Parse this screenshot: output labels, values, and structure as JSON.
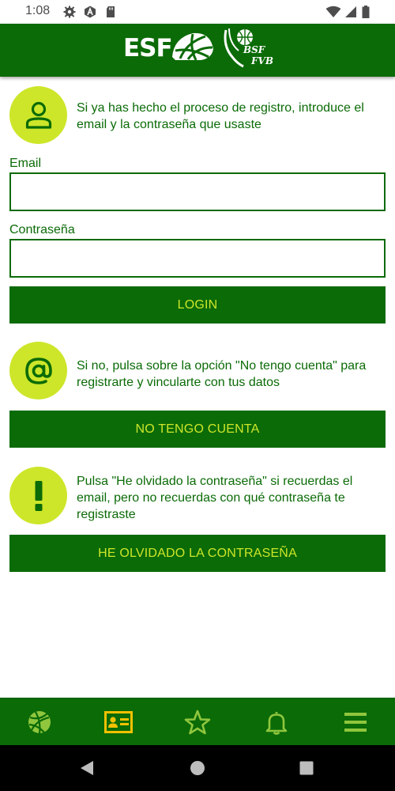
{
  "status_bar": {
    "time": "1:08",
    "icons_left": [
      "gear-icon",
      "a-icon",
      "sd-card-icon"
    ],
    "icons_right": [
      "wifi-icon",
      "signal-icon",
      "battery-icon"
    ]
  },
  "header": {
    "logo_primary": "ESF",
    "logo_secondary_line1": "BSF",
    "logo_secondary_line2": "FVB",
    "background": "#0b6b07"
  },
  "login_section": {
    "icon": "user-icon",
    "text": "Si ya has hecho el proceso de registro, introduce el email y la contraseña que usaste",
    "email_label": "Email",
    "email_value": "",
    "password_label": "Contraseña",
    "password_value": "",
    "login_button": "LOGIN"
  },
  "register_section": {
    "icon": "at-icon",
    "text": "Si no, pulsa sobre la opción \"No tengo cuenta\" para registrarte y vincularte con tus datos",
    "button": "NO TENGO CUENTA"
  },
  "forgot_section": {
    "icon": "exclamation-icon",
    "text": "Pulsa \"He olvidado la contraseña\" si recuerdas el email, pero no recuerdas con qué contraseña te registraste",
    "button": "HE OLVIDADO LA CONTRASEÑA"
  },
  "bottom_nav": {
    "items": [
      {
        "icon": "basketball-icon",
        "active": false
      },
      {
        "icon": "id-card-icon",
        "active": true
      },
      {
        "icon": "star-icon",
        "active": false
      },
      {
        "icon": "bell-icon",
        "active": false
      },
      {
        "icon": "menu-icon",
        "active": false
      }
    ]
  },
  "colors": {
    "primary_green": "#0b6b07",
    "accent_lime": "#cde62a",
    "active_yellow": "#f2c100"
  },
  "system_nav": [
    "back-icon",
    "home-icon",
    "recents-icon"
  ]
}
